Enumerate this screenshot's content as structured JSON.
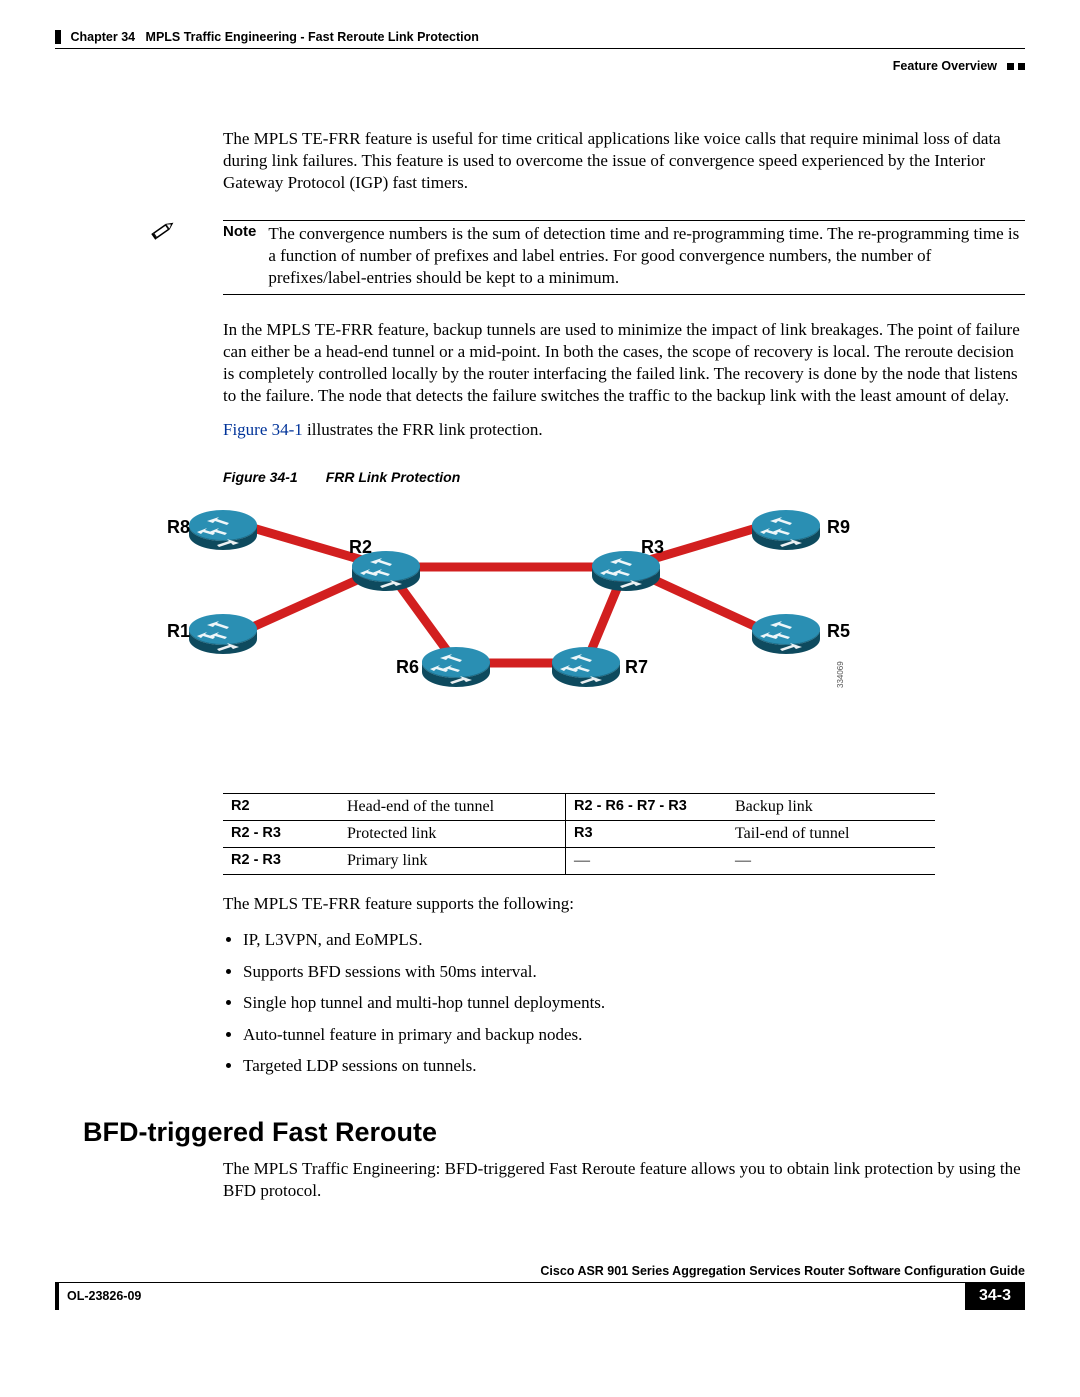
{
  "header": {
    "chapter": "Chapter 34",
    "title": "MPLS Traffic Engineering - Fast Reroute Link Protection",
    "section": "Feature Overview"
  },
  "body": {
    "p1": "The MPLS TE-FRR feature is useful for time critical applications like voice calls that require minimal loss of data during link failures. This feature is used to overcome the issue of convergence speed experienced by the Interior Gateway Protocol (IGP) fast timers.",
    "note_label": "Note",
    "note_text": "The convergence numbers is the sum of detection time and re-programming time. The re-programming time is a function of number of prefixes and label entries. For good convergence numbers, the number of prefixes/label-entries should be kept to a minimum.",
    "p2": "In the MPLS TE-FRR feature, backup tunnels are used to minimize the impact of link breakages. The point of failure can either be a head-end tunnel or a mid-point. In both the cases, the scope of recovery is local. The reroute decision is completely controlled locally by the router interfacing the failed link. The recovery is done by the node that listens to the failure. The node that detects the failure switches the traffic to the backup link with the least amount of delay.",
    "p3_pre": "",
    "figref": "Figure 34-1",
    "p3_post": " illustrates the FRR link protection.",
    "fig_num": "Figure 34-1",
    "fig_title": "FRR Link Protection",
    "img_code": "334069",
    "routers": {
      "r1": "R1",
      "r2": "R2",
      "r3": "R3",
      "r5": "R5",
      "r6": "R6",
      "r7": "R7",
      "r8": "R8",
      "r9": "R9"
    },
    "table": {
      "r1c1": "R2",
      "r1c2": "Head-end of the tunnel",
      "r1c3": "R2 - R6 - R7 - R3",
      "r1c4": "Backup link",
      "r2c1": "R2 - R3",
      "r2c2": "Protected link",
      "r2c3": "R3",
      "r2c4": "Tail-end of tunnel",
      "r3c1": "R2 - R3",
      "r3c2": "Primary link",
      "r3c3": "—",
      "r3c4": "—"
    },
    "supports_intro": "The MPLS TE-FRR feature supports the following:",
    "bullets": [
      "IP, L3VPN, and EoMPLS.",
      "Supports BFD sessions with 50ms interval.",
      "Single hop tunnel and multi-hop tunnel deployments.",
      "Auto-tunnel feature in primary and backup nodes.",
      "Targeted LDP sessions on tunnels."
    ],
    "h2": "BFD-triggered Fast Reroute",
    "p4": "The MPLS Traffic Engineering: BFD-triggered Fast Reroute feature allows you to obtain link protection by using the BFD protocol."
  },
  "footer": {
    "guide": "Cisco ASR 901 Series Aggregation Services Router Software Configuration Guide",
    "docid": "OL-23826-09",
    "page": "34-3"
  }
}
